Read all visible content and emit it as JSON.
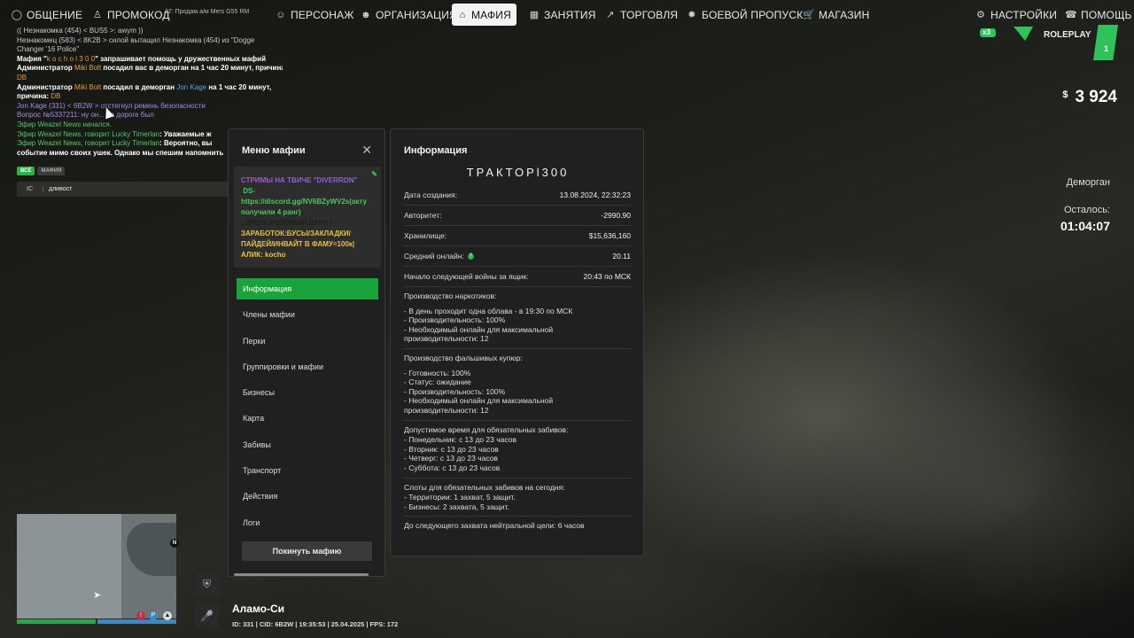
{
  "nav": {
    "items": [
      {
        "label": "ОБЩЕНИЕ",
        "icon": "chat-icon"
      },
      {
        "label": "ПРОМОКОД",
        "icon": "person-icon"
      },
      {
        "label": "ПЕРСОНАЖ",
        "icon": "user-icon"
      },
      {
        "label": "ОРГАНИЗАЦИЯ",
        "icon": "users-icon"
      },
      {
        "label": "МАФИЯ",
        "icon": "house-icon"
      },
      {
        "label": "ЗАНЯТИЯ",
        "icon": "calendar-icon"
      },
      {
        "label": "ТОРГОВЛЯ",
        "icon": "chart-icon"
      },
      {
        "label": "БОЕВОЙ ПРОПУСК",
        "icon": "gear-badge-icon"
      },
      {
        "label": "МАГАЗИН",
        "icon": "cart-icon"
      },
      {
        "label": "НАСТРОЙКИ",
        "icon": "settings-icon"
      },
      {
        "label": "ПОМОЩЬ",
        "icon": "help-icon"
      }
    ],
    "promo_ticker": "37: Продам а/м Mers G55 RM"
  },
  "logo": {
    "text": "ROLEPLAY",
    "badge": "x3",
    "num": "1"
  },
  "hud": {
    "currency": "$",
    "money": "3 924",
    "jail_label": "Деморган",
    "remaining_label": "Осталось:",
    "timer": "01:04:07",
    "location": "Аламо-Си",
    "status": "ID: 331 | CID: 6B2W | 19:35:53    | 25.04.2025 | FPS: 172"
  },
  "chat": {
    "lines": [
      [
        {
          "t": "(( Незнакомка (454) < BUS5 >: awym ))",
          "c": "c-gray"
        }
      ],
      [
        {
          "t": "Незнакомец (583) < 8K2B > силой вытащил Незнакомка (454) из \"Dogge",
          "c": "c-gray"
        }
      ],
      [
        {
          "t": "Changer '16 Police\"",
          "c": "c-gray"
        }
      ],
      [
        {
          "t": "Мафия \"",
          "c": "c-white"
        },
        {
          "t": "k o c h o l 3 0 0",
          "c": "c-orange"
        },
        {
          "t": "\" запрашивает помощь у дружественных мафий",
          "c": "c-white"
        }
      ],
      [
        {
          "t": "Администратор ",
          "c": "c-white"
        },
        {
          "t": "Miki Bolt",
          "c": "c-orange"
        },
        {
          "t": " посадил вас в деморган на 1 час 20 минут, причина:",
          "c": "c-white"
        }
      ],
      [
        {
          "t": "DB",
          "c": "c-orange"
        }
      ],
      [
        {
          "t": "Администратор ",
          "c": "c-white"
        },
        {
          "t": "Miki Bolt",
          "c": "c-orange"
        },
        {
          "t": " посадил в деморган ",
          "c": "c-white"
        },
        {
          "t": "Jon Kage",
          "c": "c-blue"
        },
        {
          "t": " на 1 час 20 минут,",
          "c": "c-white"
        }
      ],
      [
        {
          "t": "причина: ",
          "c": "c-white"
        },
        {
          "t": "DB",
          "c": "c-orange"
        }
      ],
      [
        {
          "t": "Jon Kage (331) < 6B2W > отстегнул ремень безопасности",
          "c": "c-purple"
        }
      ],
      [
        {
          "t": "Вопрос №5337211: ну он... на дороге был",
          "c": "c-purple"
        }
      ],
      [
        {
          "t": "Эфир Weazel News начался.",
          "c": "c-green"
        }
      ],
      [
        {
          "t": "Эфир Weazel News, говорит ",
          "c": "c-green"
        },
        {
          "t": "Lucky Timerlan",
          "c": "c-green"
        },
        {
          "t": ": Уважаемые ж",
          "c": "c-white"
        }
      ],
      [
        {
          "t": "Эфир Weazel News, говорит ",
          "c": "c-green"
        },
        {
          "t": "Lucky Timerlan",
          "c": "c-green"
        },
        {
          "t": ": Вероятно, вы",
          "c": "c-white"
        }
      ],
      [
        {
          "t": "событие мимо своих ушек. Однако мы спешим напомнить",
          "c": "c-white"
        }
      ]
    ],
    "tabs": [
      "ВСЁ",
      "МАФИЯ"
    ],
    "input_prefix": "IC",
    "input_value": "дливост"
  },
  "menu": {
    "title": "Меню мафии",
    "motd": [
      {
        "t": "СТРИМЫ НА ТВИЧЕ \"DIVERRON\"",
        "c": "p"
      },
      {
        "t": " |",
        "c": "d"
      },
      {
        "t": "DS-",
        "c": "g"
      },
      {
        "t": "https://discord.gg/NV6BZyWV2s(акту",
        "c": "g"
      },
      {
        "t": "получили 4 ранг)",
        "c": "g"
      },
      {
        "t": " | ДРЕСС",
        "c": "d"
      },
      {
        "t": "РОЗОВЫЙ ВЕРХ |",
        "c": "d"
      },
      {
        "t": "ЗАРАБОТОК:БУСЫ/ЗАКЛАДКИ/",
        "c": "y"
      },
      {
        "t": "ПАЙДЕЙ/ИНВАЙТ В ФАМУ=100к|",
        "c": "y"
      },
      {
        "t": "АЛИК: kocho",
        "c": "y"
      }
    ],
    "items": [
      "Информация",
      "Члены мафии",
      "Перки",
      "Группировки и мафии",
      "Бизнесы",
      "Карта",
      "Забивы",
      "Транспорт",
      "Действия",
      "Логи"
    ],
    "leave": "Покинуть мафию"
  },
  "info": {
    "title": "Информация",
    "org_name": "ТРАКТОРl300",
    "rows": [
      {
        "k": "Дата создания:",
        "v": "13.08.2024, 22:32:23"
      },
      {
        "k": "Авторитет:",
        "v": "-2990.90"
      },
      {
        "k": "Хранилище:",
        "v": "$15,636,160"
      },
      {
        "k": "Средний онлайн:",
        "v": "20.11"
      },
      {
        "k": "Начало следующей войны за ящик:",
        "v": "20:43 по МСК"
      }
    ],
    "blocks": [
      {
        "h": "Производство наркотиков:",
        "lines": [
          "- В день проходит одна облава - в 19:30 по МСК",
          "- Производительность: 100%",
          "- Необходимый онлайн для максимальной",
          "производительности: 12"
        ]
      },
      {
        "h": "Производство фальшивых купюр:",
        "lines": [
          "- Готовность: 100%",
          "- Статус: ожидание",
          "- Производительность: 100%",
          "- Необходимый онлайн для максимальной",
          "производительности: 12"
        ]
      },
      {
        "h": "Допустимое время для обязательных забивов:",
        "lines": [
          "- Понедельник: с 13 до 23 часов",
          "- Вторник: с 13 до 23 часов",
          "- Четверг: с 13 до 23 часов",
          "- Суббота: с 13 до 23 часов"
        ]
      },
      {
        "h": "Слоты для обязательных забивов на сегодня:",
        "lines": [
          "- Территории: 1 захват, 5 защит.",
          "- Бизнесы: 2 захвата, 5 защит."
        ]
      },
      {
        "h": "До следующего захвата нейтральной цели: 6 часов",
        "lines": []
      }
    ]
  },
  "minimap": {
    "north": "N"
  }
}
